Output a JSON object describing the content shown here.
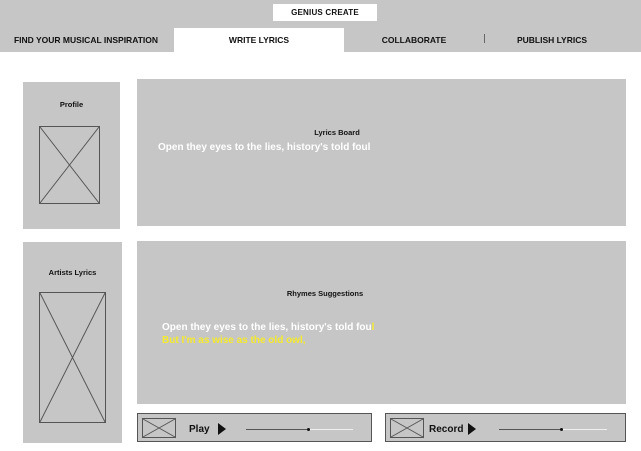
{
  "app": {
    "title": "GENIUS CREATE"
  },
  "tabs": [
    {
      "label": "FIND YOUR MUSICAL INSPIRATION",
      "active": false
    },
    {
      "label": "WRITE LYRICS",
      "active": true
    },
    {
      "label": "COLLABORATE",
      "active": false
    },
    {
      "label": "PUBLISH LYRICS",
      "active": false
    }
  ],
  "profile": {
    "title": "Profile"
  },
  "lyrics_board": {
    "title": "Lyrics Board",
    "line": "Open they eyes to the lies, history's told foul"
  },
  "artists": {
    "title": "Artists Lyrics"
  },
  "rhymes": {
    "title": "Rhymes Suggestions",
    "line1_main": "Open they eyes to the lies, history's told fou",
    "line1_highlight": "l",
    "line2": "But I'm as wise as the old owl,"
  },
  "player": {
    "play_label": "Play",
    "record_label": "Record",
    "play_progress": 0.57,
    "record_progress": 0.55
  },
  "colors": {
    "panel": "#c6c6c6",
    "highlight": "#f5ea2b",
    "text_light": "#ffffff"
  }
}
